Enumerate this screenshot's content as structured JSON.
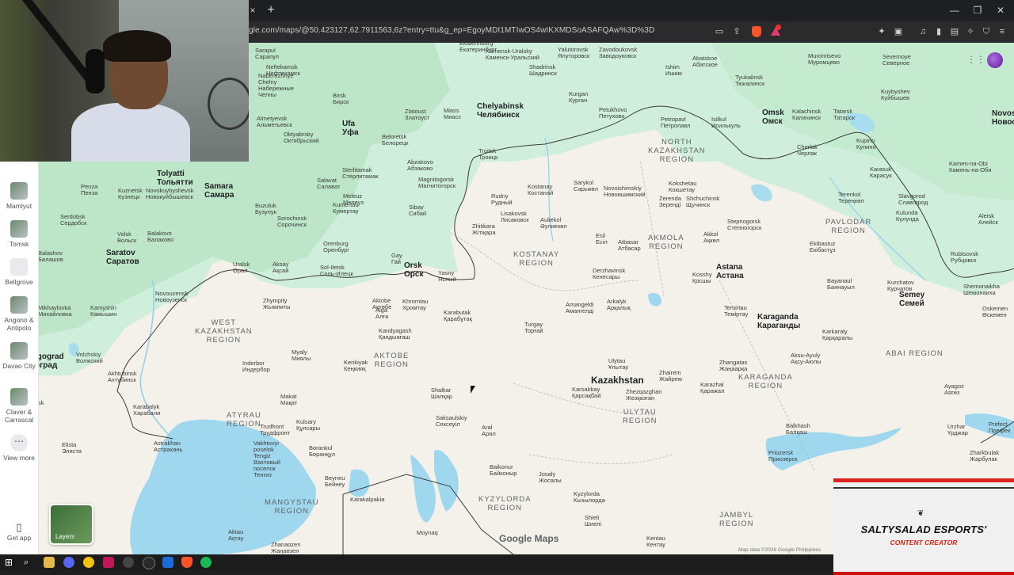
{
  "browser": {
    "url": "gle.com/maps/@50.423127,62.7911563,6z?entry=ttu&g_ep=EgoyMDI1MTIwOS4wIKXMDSoASAFQAw%3D%3D",
    "new_tab_label": "+",
    "close_tab_label": "×",
    "minimize_label": "—",
    "restore_label": "❐",
    "close_label": "✕"
  },
  "sidebar": {
    "items": [
      {
        "label": "Mamlyut"
      },
      {
        "label": "Tomsk"
      },
      {
        "label": "Bellgrove"
      },
      {
        "label": "Angono & Antipolo"
      },
      {
        "label": "Davao City"
      },
      {
        "label": "Claver & Carrascal"
      }
    ],
    "view_more": "View more",
    "get_app": "Get app"
  },
  "map": {
    "layers_label": "Layers",
    "logo_text": "Google Maps",
    "attribution": "Map data ©2026 Google    Philippines",
    "country": "Kazakhstan",
    "regions": [
      {
        "name": "NORTH\nKAZAKHSTAN\nREGION"
      },
      {
        "name": "KOSTANAY\nREGION"
      },
      {
        "name": "AKMOLA\nREGION"
      },
      {
        "name": "PAVLODAR\nREGION"
      },
      {
        "name": "WEST\nKAZAKHSTAN\nREGION"
      },
      {
        "name": "AKTOBE\nREGION"
      },
      {
        "name": "KARAGANDA\nREGION"
      },
      {
        "name": "ULYTAU\nREGION"
      },
      {
        "name": "ABAI REGION"
      },
      {
        "name": "ATYRAU\nREGION"
      },
      {
        "name": "MANGYSTAU\nREGION"
      },
      {
        "name": "KYZYLORDA\nREGION"
      },
      {
        "name": "JAMBYL\nREGION"
      }
    ],
    "cities": [
      {
        "name": "Ekaterinburg\nЕкатеринбург",
        "big": false
      },
      {
        "name": "Sarapul\nСарапул",
        "big": false
      },
      {
        "name": "Kamensk-Uralsky\nКаменск-Уральский",
        "big": false
      },
      {
        "name": "Yalutorovsk\nЯлуторовск",
        "big": false
      },
      {
        "name": "Zavodoukovsk\nЗаводоуковск",
        "big": false
      },
      {
        "name": "Ishim\nИшим",
        "big": false
      },
      {
        "name": "Abatskoe\nАбатское",
        "big": false
      },
      {
        "name": "Muromtsevo\nМуромцево",
        "big": false
      },
      {
        "name": "Severnoye\nСеверное",
        "big": false
      },
      {
        "name": "Neftekamsk\nНефтекамск",
        "big": false
      },
      {
        "name": "Shadrinsk\nШадринск",
        "big": false
      },
      {
        "name": "Tyukalinsk\nТюкалинск",
        "big": false
      },
      {
        "name": "Kuybyshev\nКуйбышев",
        "big": false
      },
      {
        "name": "Naberezhnye\nChelny\nНабережные\nЧелны",
        "big": false
      },
      {
        "name": "Birsk\nБирск",
        "big": false
      },
      {
        "name": "Kurgan\nКурган",
        "big": false
      },
      {
        "name": "Chelyabinsk\nЧелябинск",
        "big": true
      },
      {
        "name": "Miass\nМиасс",
        "big": false
      },
      {
        "name": "Zlatoust\nЗлатоуст",
        "big": false
      },
      {
        "name": "Petukhovo\nПетухово",
        "big": false
      },
      {
        "name": "Petropavl\nПетропавл",
        "big": false
      },
      {
        "name": "Isilkul\nИсилькуль",
        "big": false
      },
      {
        "name": "Omsk\nОмск",
        "big": true
      },
      {
        "name": "Kalachinsk\nКалачинск",
        "big": false
      },
      {
        "name": "Tatarsk\nТатарск",
        "big": false
      },
      {
        "name": "Novos\nНовос",
        "big": true
      },
      {
        "name": "Almetyevsk\nАльметьевск",
        "big": false
      },
      {
        "name": "Ufa\nУфа",
        "big": true
      },
      {
        "name": "Oktyabrsky\nОктябрьский",
        "big": false
      },
      {
        "name": "Beloretsk\nБелорецк",
        "big": false
      },
      {
        "name": "Troitsk\nТроицк",
        "big": false
      },
      {
        "name": "Cherlak\nЧерлак",
        "big": false
      },
      {
        "name": "Kupino\nКупино",
        "big": false
      },
      {
        "name": "Abzakovo\nАбзаково",
        "big": false
      },
      {
        "name": "Sterlitamak\nСтерлитамак",
        "big": false
      },
      {
        "name": "Magnitogorsk\nМагнитогорск",
        "big": false
      },
      {
        "name": "Kostanay\nКостанай",
        "big": false
      },
      {
        "name": "Sarykol\nСарыкөл",
        "big": false
      },
      {
        "name": "Kokshetau\nКокшетау",
        "big": false
      },
      {
        "name": "Karasuk\nКарасук",
        "big": false
      },
      {
        "name": "Kamen-na-Obi\nКамень-на-Оби",
        "big": false
      },
      {
        "name": "Tolyatti\nТольятти",
        "big": true
      },
      {
        "name": "Kuznetsk\nКузнецк",
        "big": false
      },
      {
        "name": "Novokuybyshevsk\nНовокуйбышевск",
        "big": false
      },
      {
        "name": "Samara\nСамара",
        "big": true
      },
      {
        "name": "Salavat\nСалават",
        "big": false
      },
      {
        "name": "Meleuz\nМелеуз",
        "big": false
      },
      {
        "name": "Rudny\nРудный",
        "big": false
      },
      {
        "name": "Novoishimskiy\nНовоишимский",
        "big": false
      },
      {
        "name": "Zerenda\nЗеренді",
        "big": false
      },
      {
        "name": "Shchuchinsk\nЩучинск",
        "big": false
      },
      {
        "name": "Terenkol\nТереңкөл",
        "big": false
      },
      {
        "name": "Slavgorod\nСлавгород",
        "big": false
      },
      {
        "name": "Penza\nПенза",
        "big": false
      },
      {
        "name": "Buzuluk\nБузулук",
        "big": false
      },
      {
        "name": "Kumertau\nКумертау",
        "big": false
      },
      {
        "name": "Sibay\nСибай",
        "big": false
      },
      {
        "name": "Lisakovsk\nЛисаковск",
        "big": false
      },
      {
        "name": "Auliekol\nӘулиекөл",
        "big": false
      },
      {
        "name": "Stepnogorsk\nСтепногорск",
        "big": false
      },
      {
        "name": "Kulunda\nКулунда",
        "big": false
      },
      {
        "name": "Aleisk\nАлейск",
        "big": false
      },
      {
        "name": "Serdobsk\nСердобск",
        "big": false
      },
      {
        "name": "Sorochinsk\nСорочинск",
        "big": false
      },
      {
        "name": "Zhitikara\nЖітіқара",
        "big": false
      },
      {
        "name": "Volsk\nВольск",
        "big": false
      },
      {
        "name": "Balakovo\nБалаково",
        "big": false
      },
      {
        "name": "Esil\nЕсіл",
        "big": false
      },
      {
        "name": "Atbasar\nАтбасар",
        "big": false
      },
      {
        "name": "Akkol\nАқкөл",
        "big": false
      },
      {
        "name": "Orenburg\nОренбург",
        "big": false
      },
      {
        "name": "Gay\nГай",
        "big": false
      },
      {
        "name": "Orsk\nОрск",
        "big": true
      },
      {
        "name": "Ekibastuz\nЕкібастұз",
        "big": false
      },
      {
        "name": "Rubtsovsk\nРубцовск",
        "big": false
      },
      {
        "name": "Balashov\nБалашов",
        "big": false
      },
      {
        "name": "Saratov\nСаратов",
        "big": true
      },
      {
        "name": "Uralsk\nОрал",
        "big": false
      },
      {
        "name": "Aksay\nАқсай",
        "big": false
      },
      {
        "name": "Sol-Iletsk\nСоль-Илецк",
        "big": false
      },
      {
        "name": "Yasny\nЯсный",
        "big": false
      },
      {
        "name": "Derzhavinsk\nКенесары",
        "big": false
      },
      {
        "name": "Astana\nАстана",
        "big": true
      },
      {
        "name": "Kosshy\nҚосшы",
        "big": false
      },
      {
        "name": "Shemonaikha\nШемонаиха",
        "big": false
      },
      {
        "name": "Novouzensk\nНовоузенск",
        "big": false
      },
      {
        "name": "Zhympity\nЖымпиты",
        "big": false
      },
      {
        "name": "Aktobe\nАқтөбе",
        "big": false
      },
      {
        "name": "Khromtau\nХромтау",
        "big": false
      },
      {
        "name": "Bayanaul\nБаянауыл",
        "big": false
      },
      {
        "name": "Kurchatov\nКурчатов",
        "big": false
      },
      {
        "name": "Mikhaylovka\nМихайловка",
        "big": false
      },
      {
        "name": "Kamyshin\nКамышин",
        "big": false
      },
      {
        "name": "Alga\nАлға",
        "big": false
      },
      {
        "name": "Karabutak\nҚарабұтақ",
        "big": false
      },
      {
        "name": "Amangeldi\nАмангелді",
        "big": false
      },
      {
        "name": "Arkalyk\nАрқалық",
        "big": false
      },
      {
        "name": "Temirtau\nТеміртау",
        "big": false
      },
      {
        "name": "Karaganda\nКараганды",
        "big": true
      },
      {
        "name": "Semey\nСемей",
        "big": true
      },
      {
        "name": "Oskemen\nӨскемен",
        "big": false
      },
      {
        "name": "Kandyagash\nҚандыағаш",
        "big": false
      },
      {
        "name": "Turgay\nТорғай",
        "big": false
      },
      {
        "name": "Karkaraly\nҚарқаралы",
        "big": false
      },
      {
        "name": "lgograd\nоград",
        "big": true
      },
      {
        "name": "Volzhskiy\nВолжский",
        "big": false
      },
      {
        "name": "Myaly\nМиялы",
        "big": false
      },
      {
        "name": "Akhtubinsk\nАхтубинск",
        "big": false
      },
      {
        "name": "Inderbor\nИндербор",
        "big": false
      },
      {
        "name": "Kenkiyak\nКеңкияқ",
        "big": false
      },
      {
        "name": "Ulytau\nҰлытау",
        "big": false
      },
      {
        "name": "Aksu-Ayuly\nАқсу-Аюлы",
        "big": false
      },
      {
        "name": "Zhairem\nЖайрем",
        "big": false
      },
      {
        "name": "Karazhal\nҚаражал",
        "big": false
      },
      {
        "name": "Zhangatas\nЖаңаарқа",
        "big": false
      },
      {
        "name": "Ayagoz\nАягөз",
        "big": false
      },
      {
        "name": "Karabalyk\nХарабали",
        "big": false
      },
      {
        "name": "Makat\nМақат",
        "big": false
      },
      {
        "name": "Shalkar\nШалқар",
        "big": false
      },
      {
        "name": "Karsakbay\nҚарсақбай",
        "big": false
      },
      {
        "name": "Zhezqazghan\nЖезқазған",
        "big": false
      },
      {
        "name": "Saksaulskiy\nСексеуіл",
        "big": false
      },
      {
        "name": "Kulsary\nҚұлсары",
        "big": false
      },
      {
        "name": "Aral\nАрал",
        "big": false
      },
      {
        "name": "Balkhash\nБалқаш",
        "big": false
      },
      {
        "name": "Urzhar\nҮрджар",
        "big": false
      },
      {
        "name": "Prefect\nПрефек",
        "big": false
      },
      {
        "name": "Elista\nЭлиста",
        "big": false
      },
      {
        "name": "Trudfront\nТрудфронт",
        "big": false
      },
      {
        "name": "Astrakhan\nАстрахань",
        "big": false
      },
      {
        "name": "Borankul\nБоранқұл",
        "big": false
      },
      {
        "name": "Priozersk\nПриозерск",
        "big": false
      },
      {
        "name": "Zharkbulak\nЖарбулак",
        "big": false
      },
      {
        "name": "Vakhtovyi\nposelok\nTengiz\nВахтовый\nпоселок\nТенгиз",
        "big": false
      },
      {
        "name": "Beyneu\nБейнеу",
        "big": false
      },
      {
        "name": "Baikonur\nБайконыр",
        "big": false
      },
      {
        "name": "Josaly\nЖосалы",
        "big": false
      },
      {
        "name": "Karakalpakia",
        "big": false
      },
      {
        "name": "Kyzylorda\nКызылорда",
        "big": false
      },
      {
        "name": "Shieli\nШиелі",
        "big": false
      },
      {
        "name": "Aktau\nАқтау",
        "big": false
      },
      {
        "name": "Moynaq",
        "big": false
      },
      {
        "name": "Kentau\nКентау",
        "big": false
      },
      {
        "name": "Zhanaozen\nЖаңаөзен",
        "big": false
      },
      {
        "name": "sk",
        "big": false
      }
    ]
  },
  "overlay": {
    "title": "SALTYSALAD ESPORTS'",
    "subtitle": "CONTENT CREATOR",
    "logo_glyph": "❦"
  },
  "colors": {
    "map_land": "#f3f1e9",
    "map_green": "#c9ecd5",
    "map_water": "#9fd8ee",
    "border_line": "#3c3c3c",
    "overlay_red": "#dd2222"
  }
}
